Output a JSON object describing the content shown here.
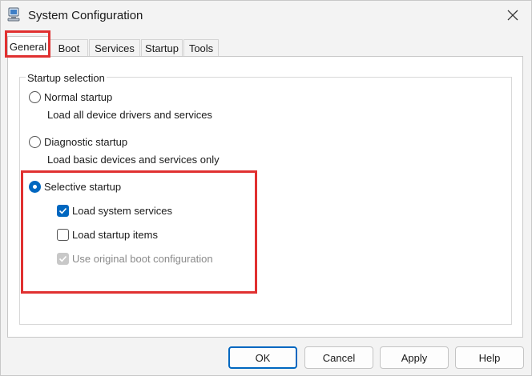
{
  "window": {
    "title": "System Configuration"
  },
  "tabs": [
    {
      "label": "General",
      "active": true
    },
    {
      "label": "Boot",
      "active": false
    },
    {
      "label": "Services",
      "active": false
    },
    {
      "label": "Startup",
      "active": false
    },
    {
      "label": "Tools",
      "active": false
    }
  ],
  "startup_selection": {
    "group_label": "Startup selection",
    "normal": {
      "label": "Normal startup",
      "description": "Load all device drivers and services",
      "selected": false
    },
    "diagnostic": {
      "label": "Diagnostic startup",
      "description": "Load basic devices and services only",
      "selected": false
    },
    "selective": {
      "label": "Selective startup",
      "selected": true,
      "options": [
        {
          "label": "Load system services",
          "checked": true,
          "disabled": false
        },
        {
          "label": "Load startup items",
          "checked": false,
          "disabled": false
        },
        {
          "label": "Use original boot configuration",
          "checked": true,
          "disabled": true
        }
      ]
    }
  },
  "buttons": {
    "ok": "OK",
    "cancel": "Cancel",
    "apply": "Apply",
    "help": "Help"
  },
  "colors": {
    "accent": "#0067c0",
    "highlight": "#e03030"
  }
}
